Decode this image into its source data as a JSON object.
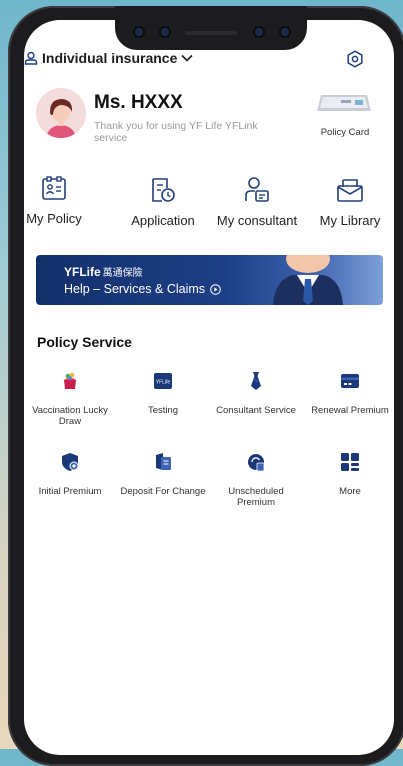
{
  "header": {
    "insurance_type": "Individual insurance"
  },
  "profile": {
    "name": "Ms. HXXX",
    "thanks": "Thank you for using YF Life YFLink service",
    "policy_card_label": "Policy Card"
  },
  "quick_actions": [
    {
      "label": "My Policy",
      "icon": "policy-id-icon"
    },
    {
      "label": "Application",
      "icon": "application-clock-icon"
    },
    {
      "label": "My consultant",
      "icon": "consultant-icon"
    },
    {
      "label": "My Library",
      "icon": "library-envelope-icon"
    }
  ],
  "banner": {
    "brand": "YFLife",
    "brand_sub": "萬通保險",
    "help_text": "Help – Services & Claims"
  },
  "policy_service": {
    "title": "Policy Service",
    "items": [
      {
        "label": "Vaccination Lucky Draw",
        "icon": "gift-icon"
      },
      {
        "label": "Testing",
        "icon": "yflife-logo-icon"
      },
      {
        "label": "Consultant Service",
        "icon": "tie-icon"
      },
      {
        "label": "Renewal Premium",
        "icon": "card-icon"
      },
      {
        "label": "Initial Premium",
        "icon": "shield-plus-icon"
      },
      {
        "label": "Deposit For Change",
        "icon": "deposit-doc-icon"
      },
      {
        "label": "Unscheduled Premium",
        "icon": "refresh-doc-icon"
      },
      {
        "label": "More",
        "icon": "grid-more-icon"
      }
    ]
  },
  "colors": {
    "accent": "#1c3f86",
    "icon_navy": "#233f7a",
    "banner_dark": "#13306b"
  }
}
